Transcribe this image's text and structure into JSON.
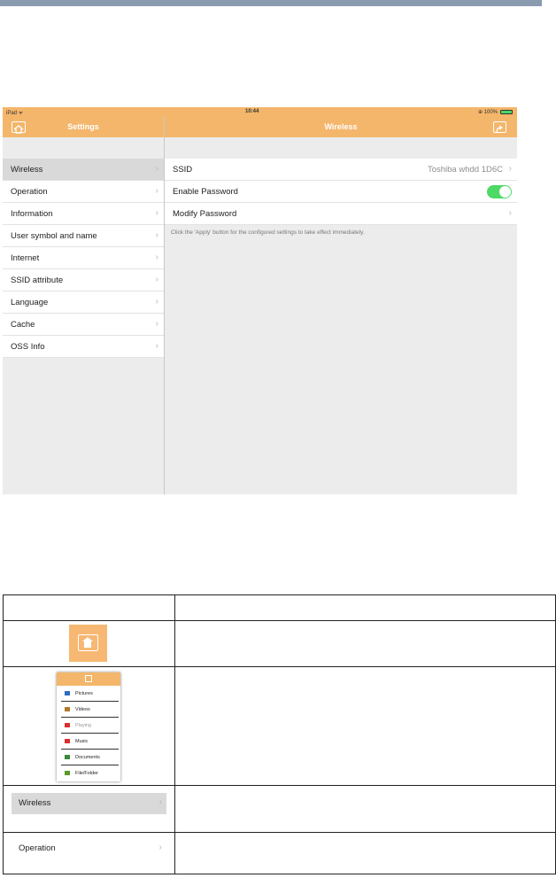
{
  "statusbar": {
    "device": "iPad ᯤ",
    "time": "10:44",
    "battery": "⊕ 100%",
    "battery_level": 1.0
  },
  "left_nav": {
    "title": "Settings"
  },
  "right_nav": {
    "title": "Wireless"
  },
  "sidebar": {
    "items": [
      {
        "label": "Wireless",
        "selected": true
      },
      {
        "label": "Operation"
      },
      {
        "label": "Information"
      },
      {
        "label": "User symbol and name"
      },
      {
        "label": "Internet"
      },
      {
        "label": "SSID attribute"
      },
      {
        "label": "Language"
      },
      {
        "label": "Cache"
      },
      {
        "label": "OSS Info"
      }
    ]
  },
  "detail": {
    "ssid_label": "SSID",
    "ssid_value": "Toshiba whdd 1D6C",
    "enable_password_label": "Enable Password",
    "enable_password_on": true,
    "modify_password_label": "Modify Password",
    "hint": "Click the 'Apply' button for the configured settings to take effect immediately."
  },
  "table": {
    "menu_items": [
      {
        "label": "Pictures",
        "icon": "pictures-icon",
        "color": "#2b6cc4"
      },
      {
        "label": "Videos",
        "icon": "videos-icon",
        "color": "#b07a2a"
      },
      {
        "label": "Playing",
        "icon": "playing-icon",
        "color": "#d83030"
      },
      {
        "label": "Music",
        "icon": "music-icon",
        "color": "#d83030"
      },
      {
        "label": "Documents",
        "icon": "documents-icon",
        "color": "#3a8a3a"
      },
      {
        "label": "File/Folder",
        "icon": "folder-icon",
        "color": "#5a9a2a"
      }
    ],
    "wireless_label": "Wireless",
    "operation_label": "Operation"
  },
  "colors": {
    "accent": "#f4b66b",
    "toggle_on": "#4cd964",
    "selected_row": "#d9d9d9"
  }
}
